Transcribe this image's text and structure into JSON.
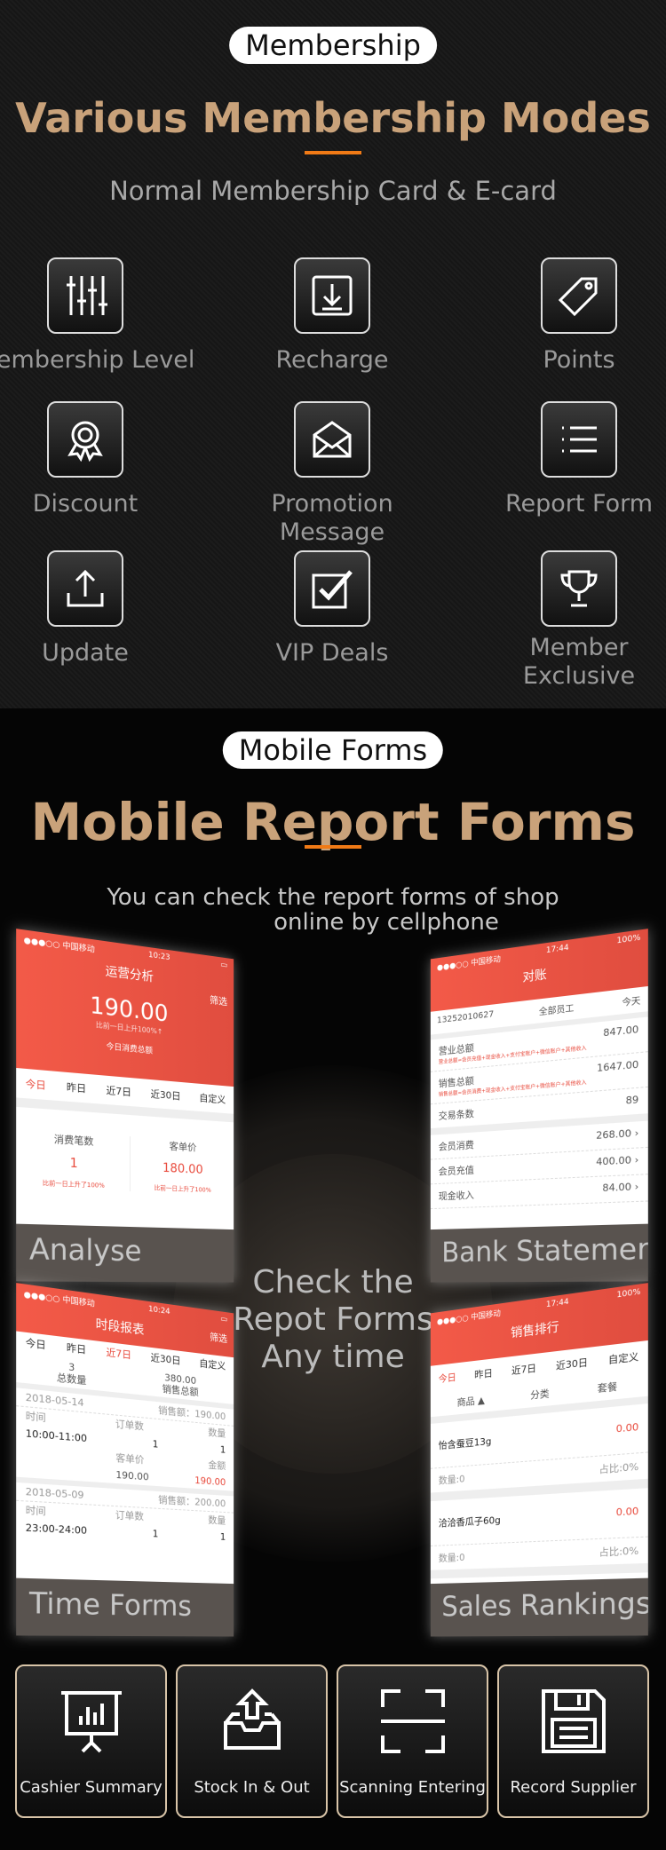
{
  "membership": {
    "badge": "Membership",
    "title": "Various Membership Modes",
    "subtitle": "Normal Membership Card & E-card",
    "features": [
      {
        "label": "Membership Level",
        "icon": "sliders-icon"
      },
      {
        "label": "Recharge",
        "icon": "download-icon"
      },
      {
        "label": "Points",
        "icon": "tag-icon"
      },
      {
        "label": "Discount",
        "icon": "award-icon"
      },
      {
        "label": "Promotion Message",
        "icon": "envelope-icon"
      },
      {
        "label": "Report Form",
        "icon": "list-icon"
      },
      {
        "label": "Update",
        "icon": "upload-icon"
      },
      {
        "label": "VIP Deals",
        "icon": "checkbox-icon"
      },
      {
        "label": "Member Exclusive",
        "icon": "trophy-icon"
      }
    ]
  },
  "forms": {
    "badge": "Mobile Forms",
    "title": "Mobile Report Forms",
    "subtitle_1": "You can check the report forms of shop",
    "subtitle_2": "online by cellphone",
    "center_1": "Check the",
    "center_2": "Repot Forms",
    "center_3": "Any time",
    "analyse": {
      "caption": "Analyse",
      "carrier": "●●●○○ 中国移动",
      "time": "10:23",
      "title": "运营分析",
      "filter": "筛选",
      "amount": "190.00",
      "compare": "比前一日上升100%↑",
      "amount_label": "今日消费总额",
      "tabs": [
        "今日",
        "昨日",
        "近7日",
        "近30日",
        "自定义"
      ],
      "stat1_label": "消费笔数",
      "stat1_value": "1",
      "stat1_note": "比前一日上升了100%",
      "stat2_label": "客单价",
      "stat2_value": "180.00",
      "stat2_note": "比前一日上升了100%"
    },
    "bank": {
      "caption": "Bank Statement",
      "carrier": "●●●○○ 中国移动",
      "time": "17:44",
      "battery": "100%",
      "title": "对账",
      "account": "13252010627",
      "staff": "全部员工",
      "period": "今天",
      "rows": [
        {
          "label": "营业总额",
          "value": "847.00",
          "note": "营业总额=会员充值+现金收入+支付宝账户+微信账户+其他收入"
        },
        {
          "label": "销售总额",
          "value": "1647.00",
          "note": "销售总额=会员消费+现金收入+支付宝账户+微信账户+其他收入"
        },
        {
          "label": "交易条数",
          "value": "89",
          "note": ""
        },
        {
          "label": "会员消费",
          "value": "268.00 ›",
          "note": ""
        },
        {
          "label": "会员充值",
          "value": "400.00 ›",
          "note": ""
        },
        {
          "label": "现金收入",
          "value": "84.00 ›",
          "note": ""
        }
      ]
    },
    "time": {
      "caption": "Time Forms",
      "carrier": "●●●○○ 中国移动",
      "time": "10:24",
      "title": "时段报表",
      "filter": "筛选",
      "tabs": [
        "今日",
        "昨日",
        "近7日",
        "近30日",
        "自定义"
      ],
      "count": "3",
      "count_label": "总数量",
      "total": "380.00",
      "total_label": "销售总额",
      "blocks": [
        {
          "date": "2018-05-14",
          "sales": "销售额：190.00",
          "time_label": "时间",
          "range": "10:00-11:00",
          "orders_label": "订单数",
          "orders": "1",
          "qty_label": "数量",
          "qty": "1",
          "price_label": "客单价",
          "price": "190.00",
          "amount_label": "金额",
          "amount": "190.00"
        },
        {
          "date": "2018-05-09",
          "sales": "销售额：200.00",
          "time_label": "时间",
          "range": "23:00-24:00",
          "orders_label": "订单数",
          "orders": "1",
          "qty_label": "数量",
          "qty": "1"
        }
      ]
    },
    "sales": {
      "caption": "Sales Rankings",
      "carrier": "●●●○○ 中国移动",
      "time": "17:44",
      "battery": "100%",
      "title": "销售排行",
      "tabs": [
        "今日",
        "昨日",
        "近7日",
        "近30日",
        "自定义"
      ],
      "cols": [
        "商品 ▲",
        "分类",
        "套餐"
      ],
      "items": [
        {
          "name": "怡含蚕豆13g",
          "value": "0.00",
          "qty": "数量:0",
          "ratio": "占比:0%"
        },
        {
          "name": "洽洽香瓜子60g",
          "value": "0.00",
          "qty": "数量:0",
          "ratio": "占比:0%"
        }
      ]
    }
  },
  "tools": [
    {
      "label": "Cashier Summary",
      "icon": "presentation-chart-icon"
    },
    {
      "label": "Stock In & Out",
      "icon": "inbox-upload-icon"
    },
    {
      "label": "Scanning Entering",
      "icon": "scan-icon"
    },
    {
      "label": "Record Supplier",
      "icon": "floppy-icon"
    }
  ]
}
